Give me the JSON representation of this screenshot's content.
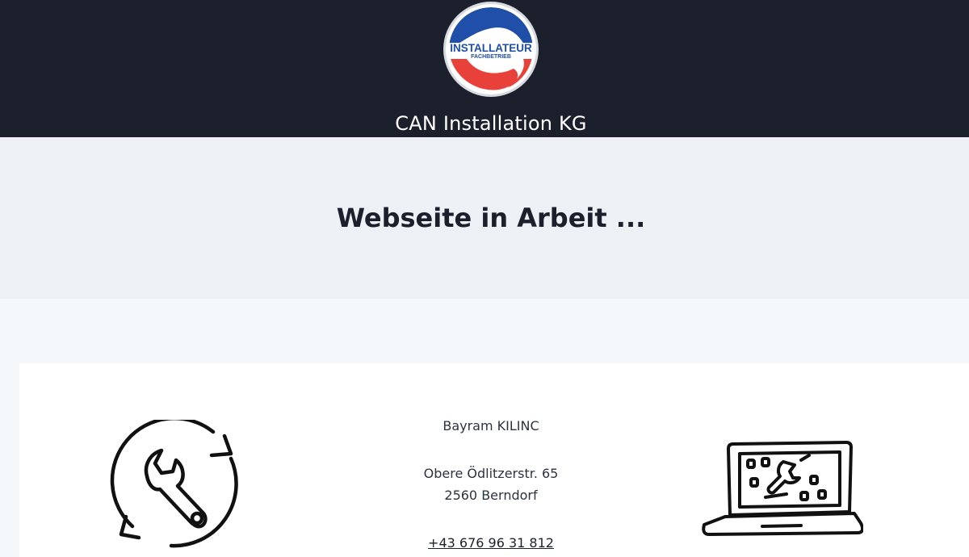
{
  "header": {
    "logo": {
      "main_text": "INSTALLATEUR",
      "sub_text": "FACHBETRIEB",
      "colors": {
        "red": "#e8413a",
        "blue": "#1f4fa8",
        "ring": "#d7dbe0"
      }
    },
    "site_title": "CAN Installation KG"
  },
  "hero": {
    "heading": "Webseite in Arbeit ..."
  },
  "contact": {
    "name": "Bayram KILINC",
    "street": "Obere Ödlitzerstr. 65",
    "city": "2560 Berndorf",
    "phone": "+43 676 96 31 812"
  },
  "illustrations": {
    "left": "wrench-refresh-icon",
    "right": "laptop-wrench-icon"
  },
  "colors": {
    "header_bg": "#1c202c",
    "hero_bg": "#edf1f5",
    "page_bg": "#f5f8fb",
    "card_bg": "#ffffff"
  }
}
